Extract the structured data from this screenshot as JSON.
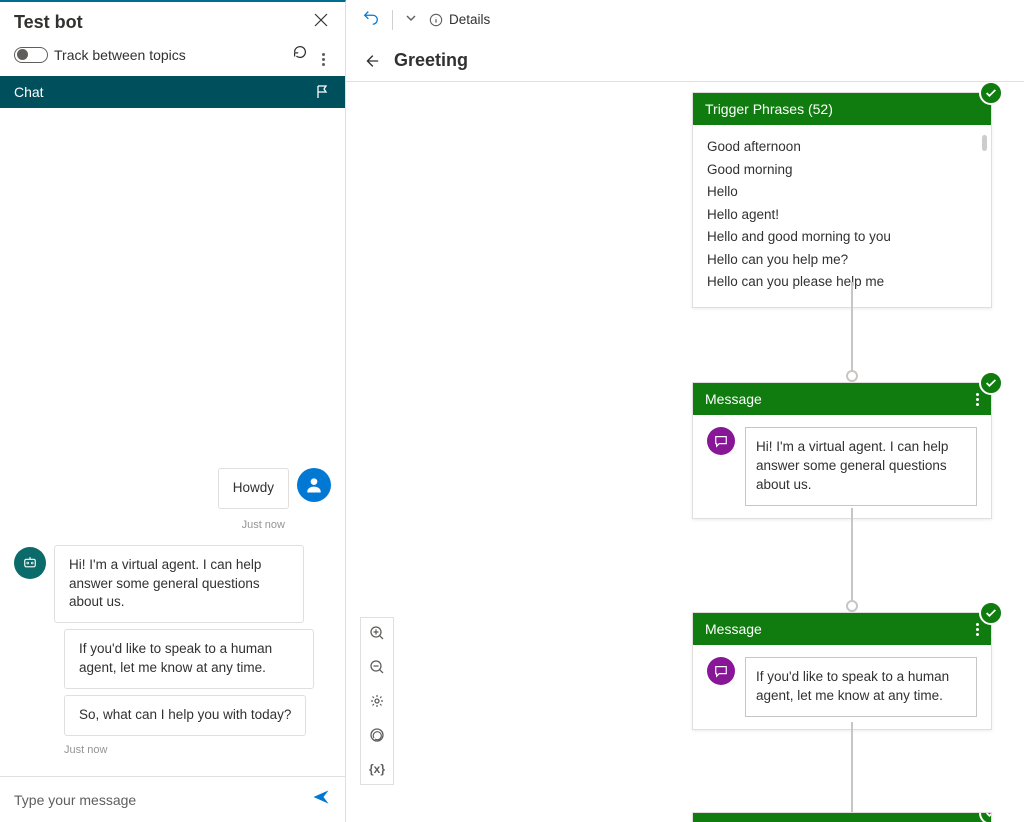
{
  "sidebar": {
    "title": "Test bot",
    "toggle_label": "Track between topics",
    "chat_tab_label": "Chat",
    "timestamp_now": "Just now",
    "input_placeholder": "Type your message",
    "user_msg": "Howdy",
    "bot_msgs": [
      "Hi! I'm a virtual agent. I can help answer some general questions about us.",
      "If you'd like to speak to a human agent, let me know at any time.",
      "So, what can I help you with today?"
    ]
  },
  "toolbar": {
    "details_label": "Details"
  },
  "header": {
    "topic_title": "Greeting"
  },
  "trigger_node": {
    "title_prefix": "Trigger Phrases",
    "count": "52",
    "phrases": [
      "Good afternoon",
      "Good morning",
      "Hello",
      "Hello agent!",
      "Hello and good morning to you",
      "Hello can you help me?",
      "Hello can you please help me"
    ]
  },
  "msg_node1": {
    "title": "Message",
    "text": "Hi! I'm a virtual agent. I can help answer some general questions about us."
  },
  "msg_node2": {
    "title": "Message",
    "text": "If you'd like to speak to a human agent, let me know at any time."
  }
}
